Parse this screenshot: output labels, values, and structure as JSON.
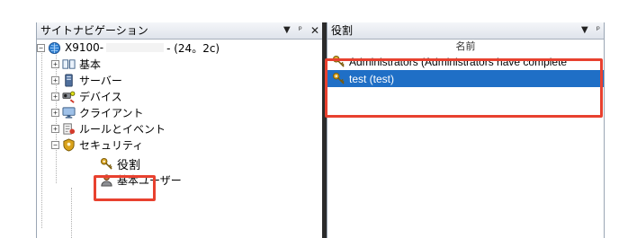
{
  "left_panel": {
    "title": "サイトナビゲーション",
    "buttons": {
      "dropdown": "▼",
      "pin": "ᵖ",
      "close": "✕"
    },
    "tree": {
      "root": {
        "name": "X9100-",
        "version": "- (24。2c)"
      },
      "items": [
        {
          "label": "基本",
          "icon": "book-icon"
        },
        {
          "label": "サーバー",
          "icon": "server-icon"
        },
        {
          "label": "デバイス",
          "icon": "devices-icon"
        },
        {
          "label": "クライアント",
          "icon": "monitor-icon"
        },
        {
          "label": "ルールとイベント",
          "icon": "rules-icon"
        },
        {
          "label": "セキュリティ",
          "icon": "security-icon"
        }
      ],
      "security_children": [
        {
          "label": "役割",
          "icon": "keys-icon"
        },
        {
          "label": "基本ユーザー",
          "icon": "user-icon"
        }
      ]
    }
  },
  "right_panel": {
    "title": "役割",
    "buttons": {
      "dropdown": "▼",
      "pin": "ᵖ"
    },
    "column_header": "名前",
    "rows": [
      {
        "name": "Administrators (Administrators have complete",
        "selected": false
      },
      {
        "name": "test (test)",
        "selected": true
      }
    ]
  },
  "colors": {
    "highlight": "#e8412f",
    "selection": "#1f6fc6"
  }
}
